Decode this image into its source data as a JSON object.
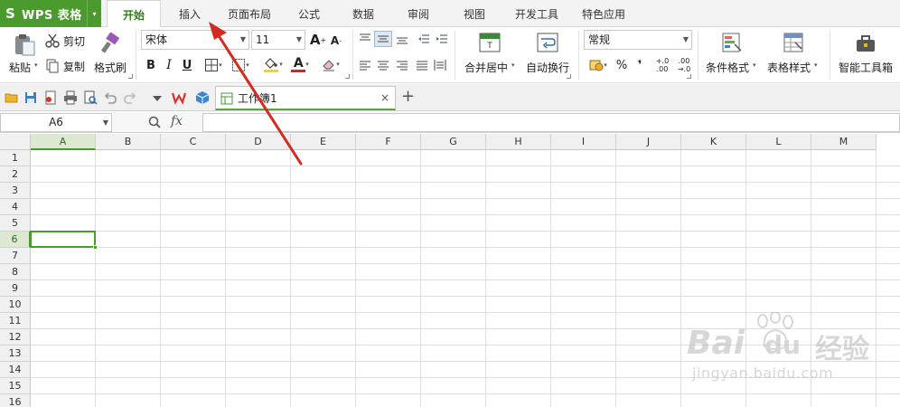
{
  "app": {
    "logo_text": "S",
    "name": "WPS 表格",
    "dropdown": "▾"
  },
  "menu": {
    "tabs": [
      "开始",
      "插入",
      "页面布局",
      "公式",
      "数据",
      "审阅",
      "视图",
      "开发工具",
      "特色应用"
    ],
    "active_tab": "开始"
  },
  "ribbon": {
    "clipboard": {
      "paste": "粘贴",
      "cut": "剪切",
      "copy": "复制",
      "format_painter": "格式刷"
    },
    "font": {
      "name": "宋体",
      "size": "11",
      "bold": "B",
      "italic": "I",
      "underline": "U",
      "grow": "A",
      "shrink": "A",
      "font_color_letter": "A",
      "fill_color": "#ffd400",
      "font_color": "#e02020"
    },
    "alignment": {
      "merge_center": "合并居中",
      "wrap_text": "自动换行"
    },
    "number": {
      "format": "常规",
      "percent": "%",
      "comma": "❜",
      "inc_decimal_top": "+.0",
      "inc_decimal_bottom": ".00",
      "dec_decimal_top": ".00",
      "dec_decimal_bottom": "→.0"
    },
    "styles": {
      "conditional_format": "条件格式",
      "table_style": "表格样式"
    },
    "tools": {
      "smart_toolbox": "智能工具箱"
    }
  },
  "document": {
    "tab_title": "工作簿1",
    "close": "×",
    "new_tab": "+"
  },
  "formula_bar": {
    "cell_ref": "A6",
    "fx": "fx"
  },
  "sheet": {
    "columns": [
      "A",
      "B",
      "C",
      "D",
      "E",
      "F",
      "G",
      "H",
      "I",
      "J",
      "K",
      "L",
      "M"
    ],
    "rows": [
      "1",
      "2",
      "3",
      "4",
      "5",
      "6",
      "7",
      "8",
      "9",
      "10",
      "11",
      "12",
      "13",
      "14",
      "15",
      "16"
    ],
    "selected_column": "A",
    "selected_row": "6"
  },
  "annotation": {
    "arrow_color": "#d42a1f"
  },
  "watermark": {
    "brand": "Bai",
    "brand_suffix": "du",
    "cn": "经验",
    "url": "jingyan.baidu.com"
  },
  "colors": {
    "accent": "#4b9a2e",
    "selected_header_bg": "#dce8d2"
  }
}
